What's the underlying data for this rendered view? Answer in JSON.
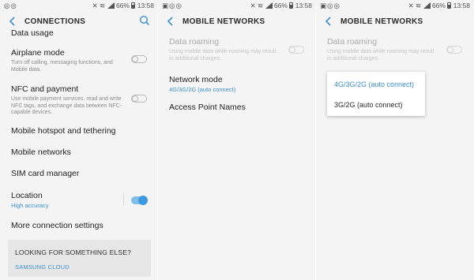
{
  "status_bar": {
    "time": "13:58",
    "battery": "66%"
  },
  "panel1": {
    "title": "CONNECTIONS",
    "partial_item": "Data usage",
    "airplane": {
      "title": "Airplane mode",
      "desc": "Turn off calling, messaging functions, and Mobile data."
    },
    "nfc": {
      "title": "NFC and payment",
      "desc": "Use mobile payment services, read and write NFC tags, and exchange data between NFC-capable devices."
    },
    "hotspot": "Mobile hotspot and tethering",
    "mobile_networks": "Mobile networks",
    "sim_manager": "SIM card manager",
    "location": {
      "title": "Location",
      "sub": "High accuracy"
    },
    "more": "More connection settings",
    "suggestion": {
      "heading": "LOOKING FOR SOMETHING ELSE?",
      "link": "SAMSUNG CLOUD"
    }
  },
  "panel2": {
    "title": "MOBILE NETWORKS",
    "roaming": {
      "title": "Data roaming",
      "desc": "Using mobile data while roaming may result in additional charges."
    },
    "network_mode": {
      "title": "Network mode",
      "value": "4G/3G/2G (auto connect)"
    },
    "apn": "Access Point Names"
  },
  "panel3": {
    "title": "MOBILE NETWORKS",
    "roaming": {
      "title": "Data roaming",
      "desc": "Using mobile data while roaming may result in additional charges."
    },
    "options": [
      "4G/3G/2G (auto connect)",
      "3G/2G (auto connect)"
    ],
    "selected": "4G/3G/2G (auto connect)"
  },
  "colors": {
    "accent": "#3e9ae0",
    "link": "#3a8fd0",
    "background": "#f4f4f4"
  }
}
